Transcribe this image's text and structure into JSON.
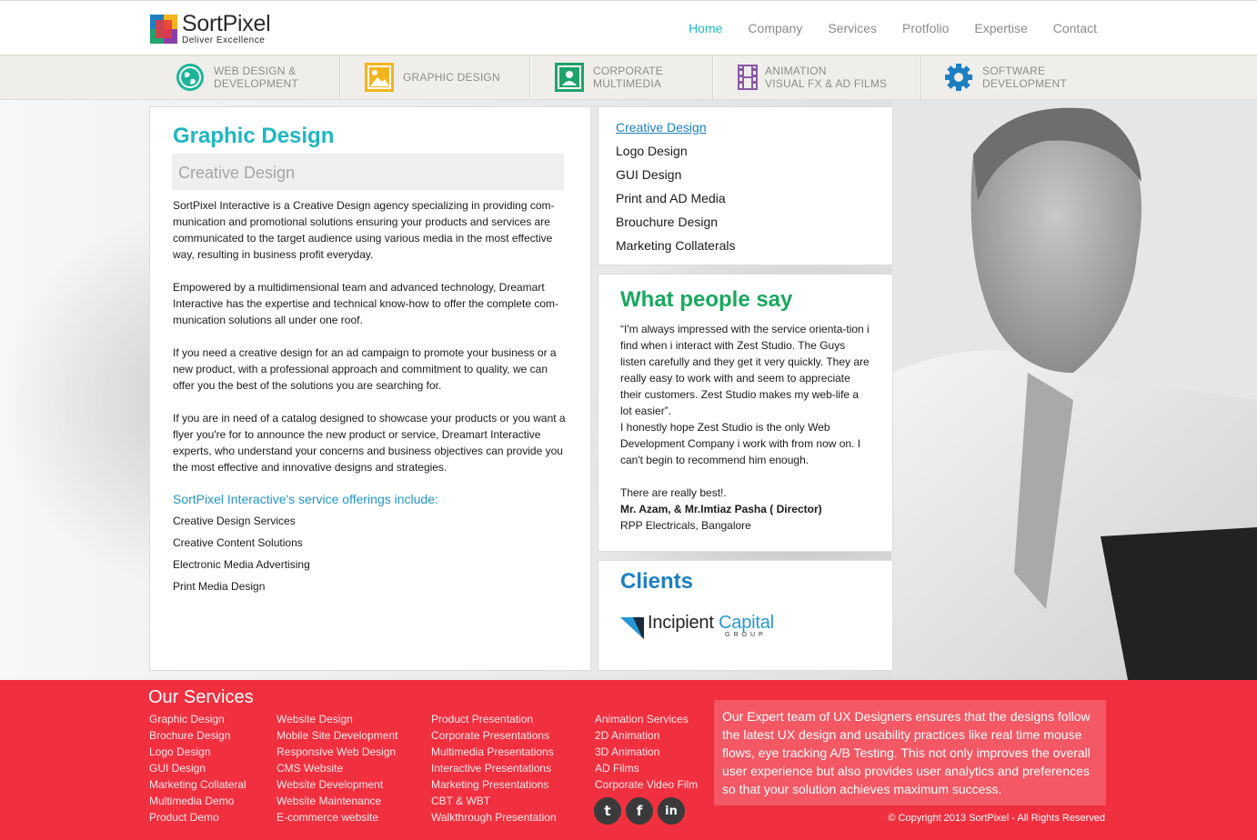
{
  "header": {
    "logo_name": "SortPixel",
    "logo_tagline": "Deliver Excellence",
    "nav": [
      "Home",
      "Company",
      "Services",
      "Protfolio",
      "Expertise",
      "Contact"
    ],
    "active_nav": "Home"
  },
  "categories": [
    {
      "line1": "WEB DESIGN &",
      "line2": "DEVELOPMENT",
      "icon": "globe-icon",
      "color": "#1cb59a"
    },
    {
      "line1": "GRAPHIC DESIGN",
      "line2": "",
      "icon": "image-icon",
      "color": "#f3b51d"
    },
    {
      "line1": "CORPORATE",
      "line2": "MULTIMEDIA",
      "icon": "user-screen-icon",
      "color": "#1ea36b"
    },
    {
      "line1": "ANIMATION",
      "line2": "VISUAL FX & AD FILMS",
      "icon": "film-icon",
      "color": "#8a58a8"
    },
    {
      "line1": "SOFTWARE",
      "line2": "DEVELOPMENT",
      "icon": "gear-icon",
      "color": "#1d7fc1"
    }
  ],
  "main": {
    "title": "Graphic Design",
    "subtitle": "Creative Design",
    "paragraphs": [
      "SortPixel Interactive is a Creative Design agency specializing in providing com-munication and promotional solutions ensuring your products and services are communicated to the target audience using various media in the most effective way, resulting in business profit everyday.",
      "Empowered by a multidimensional team and advanced technology, Dreamart Interactive has the expertise and technical know-how to offer the complete com-munication solutions all under one roof.",
      "If you need a creative design for an ad campaign to promote your business or a new product, with a professional approach and commitment to quality, we can offer you the best of the solutions you are searching for.",
      "If you are in need of a catalog designed to showcase your products or you want a flyer you're for to announce the new product or service, Dreamart Interactive experts, who understand your concerns and business objectives can provide you the most effective and innovative designs and strategies."
    ],
    "offerings_title": "SortPixel Interactive's service offerings include:",
    "offerings": [
      "Creative Design Services",
      "Creative Content Solutions",
      "Electronic Media Advertising",
      "Print Media Design"
    ]
  },
  "side_links": [
    "Creative Design",
    "Logo Design",
    "GUI Design",
    "Print and AD Media",
    "Brouchure Design",
    "Marketing Collaterals"
  ],
  "testimonial": {
    "title": "What people say",
    "quote": "“I'm always impressed with the service orienta-tion i find when i interact with Zest Studio. The Guys listen carefully and they get it very quickly. They are really easy to work with and seem to appreciate their customers. Zest Studio makes my web-life a lot easier”.",
    "quote2": "I honestly hope Zest Studio is the only Web Development Company i work with from now on. I can't begin to recommend him enough.",
    "closing": "There are really best!.",
    "author": "Mr. Azam, &  Mr.Imtiaz Pasha  ( Director)",
    "company": "RPP Electricals, Bangalore"
  },
  "clients": {
    "title": "Clients",
    "logo_word1": "Incipient",
    "logo_word2": "Capital",
    "logo_sub": "GROUP"
  },
  "footer": {
    "title": "Our Services",
    "col1": [
      "Graphic Design",
      "Brochure Design",
      "Logo Design",
      "GUI Design",
      "Marketing Collateral",
      "Multimedia Demo",
      "Product Demo"
    ],
    "col2": [
      "Website Design",
      "Mobile Site Development",
      "Responsive Web Design",
      "CMS Website",
      "Website Development",
      "Website Maintenance",
      "E-commerce website"
    ],
    "col3": [
      "Product Presentation",
      "Corporate Presentations",
      "Multimedia  Presentations",
      "Interactive  Presentations",
      "Marketing Presentations",
      "CBT & WBT",
      "Walkthrough Presentation"
    ],
    "col4": [
      "Animation Services",
      "2D Animation",
      "3D  Animation",
      "AD Films",
      "Corporate Video Film"
    ],
    "blurb": "Our Expert team of UX Designers ensures that the designs follow the  latest UX design and usability practices like real time mouse flows, eye tracking A/B Testing.  This not only improves the overall user experience but also provides user analytics and preferences so that your solution achieves maximum success.",
    "social": [
      {
        "icon": "twitter-icon",
        "glyph": "t"
      },
      {
        "icon": "facebook-icon",
        "glyph": "f"
      },
      {
        "icon": "linkedin-icon",
        "glyph": "in"
      }
    ],
    "copyright": "© Copyright 2013 SortPixel - All Rights Reserved"
  }
}
